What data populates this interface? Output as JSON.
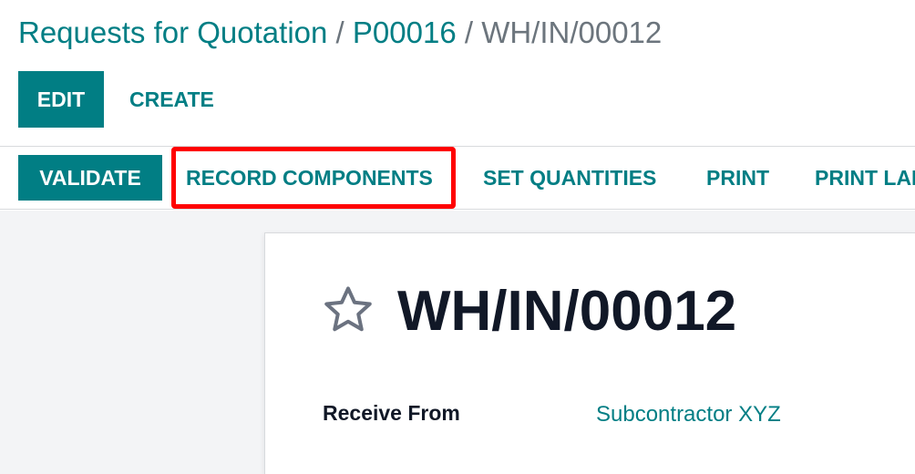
{
  "breadcrumb": {
    "items": [
      "Requests for Quotation",
      "P00016"
    ],
    "separator": "/",
    "current": "WH/IN/00012"
  },
  "control_panel": {
    "edit_label": "EDIT",
    "create_label": "CREATE"
  },
  "statusbar": {
    "validate_label": "VALIDATE",
    "record_components_label": "RECORD COMPONENTS",
    "set_quantities_label": "SET QUANTITIES",
    "print_label": "PRINT",
    "print_labels_label": "PRINT LABELS"
  },
  "form": {
    "favorite_icon": "star-outline-icon",
    "title": "WH/IN/00012",
    "fields": [
      {
        "label": "Receive From",
        "value": "Subcontractor XYZ"
      }
    ]
  },
  "colors": {
    "primary": "#017e84",
    "highlight": "#ff0000",
    "text_dark": "#111827",
    "muted": "#6c757d"
  }
}
